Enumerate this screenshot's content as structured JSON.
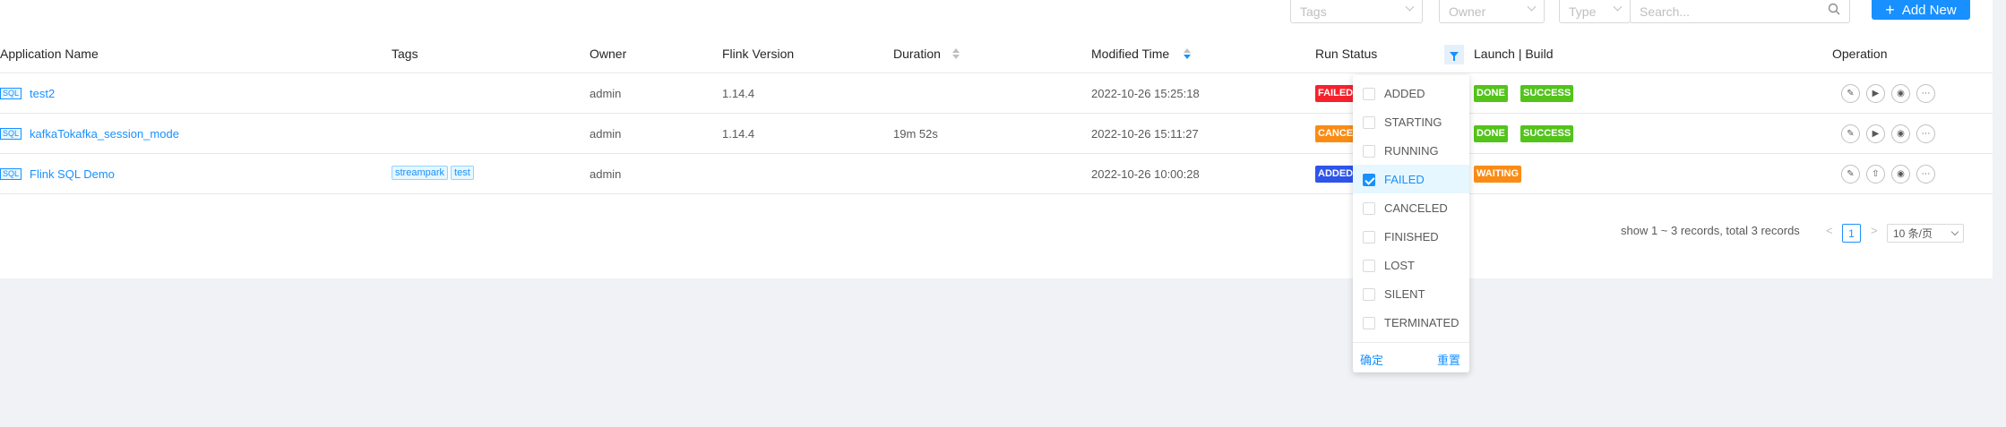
{
  "toolbar": {
    "tags_placeholder": "Tags",
    "owner_placeholder": "Owner",
    "type_placeholder": "Type",
    "search_placeholder": "Search...",
    "add_new_label": "Add New"
  },
  "columns": {
    "app_name": "Application Name",
    "tags": "Tags",
    "owner": "Owner",
    "flink_version": "Flink Version",
    "duration": "Duration",
    "modified_time": "Modified Time",
    "run_status": "Run Status",
    "launch_build": "Launch | Build",
    "operation": "Operation"
  },
  "rows": [
    {
      "type_badge": "SQL",
      "name": "test2",
      "tags": [],
      "owner": "admin",
      "flink_version": "1.14.4",
      "duration": "",
      "modified_time": "2022-10-26 15:25:18",
      "run_status": "FAILED",
      "launch": "DONE",
      "build": "SUCCESS"
    },
    {
      "type_badge": "SQL",
      "name": "kafkaTokafka_session_mode",
      "tags": [],
      "owner": "admin",
      "flink_version": "1.14.4",
      "duration": "19m 52s",
      "modified_time": "2022-10-26 15:11:27",
      "run_status": "CANCE",
      "launch": "DONE",
      "build": "SUCCESS"
    },
    {
      "type_badge": "SQL",
      "name": "Flink SQL Demo",
      "tags": [
        "streampark",
        "test"
      ],
      "owner": "admin",
      "flink_version": "",
      "duration": "",
      "modified_time": "2022-10-26 10:00:28",
      "run_status": "ADDED",
      "launch": "WAITING",
      "build": ""
    }
  ],
  "status_colors": {
    "FAILED": "#f5222d",
    "CANCE": "#fa8c16",
    "ADDED": "#2f54eb",
    "DONE": "#52c41a",
    "SUCCESS": "#52c41a",
    "WAITING": "#fa8c16"
  },
  "operation_icons": [
    "edit-icon",
    "play-icon",
    "eye-icon",
    "more-icon"
  ],
  "pagination": {
    "summary": "show 1 ~ 3 records, total 3 records",
    "current_page": "1",
    "page_size": "10 条/页"
  },
  "status_filter": {
    "options": [
      {
        "label": "ADDED",
        "checked": false
      },
      {
        "label": "STARTING",
        "checked": false
      },
      {
        "label": "RUNNING",
        "checked": false
      },
      {
        "label": "FAILED",
        "checked": true
      },
      {
        "label": "CANCELED",
        "checked": false
      },
      {
        "label": "FINISHED",
        "checked": false
      },
      {
        "label": "LOST",
        "checked": false
      },
      {
        "label": "SILENT",
        "checked": false
      },
      {
        "label": "TERMINATED",
        "checked": false
      }
    ],
    "confirm_label": "确定",
    "reset_label": "重置"
  },
  "accent": "#1890ff"
}
